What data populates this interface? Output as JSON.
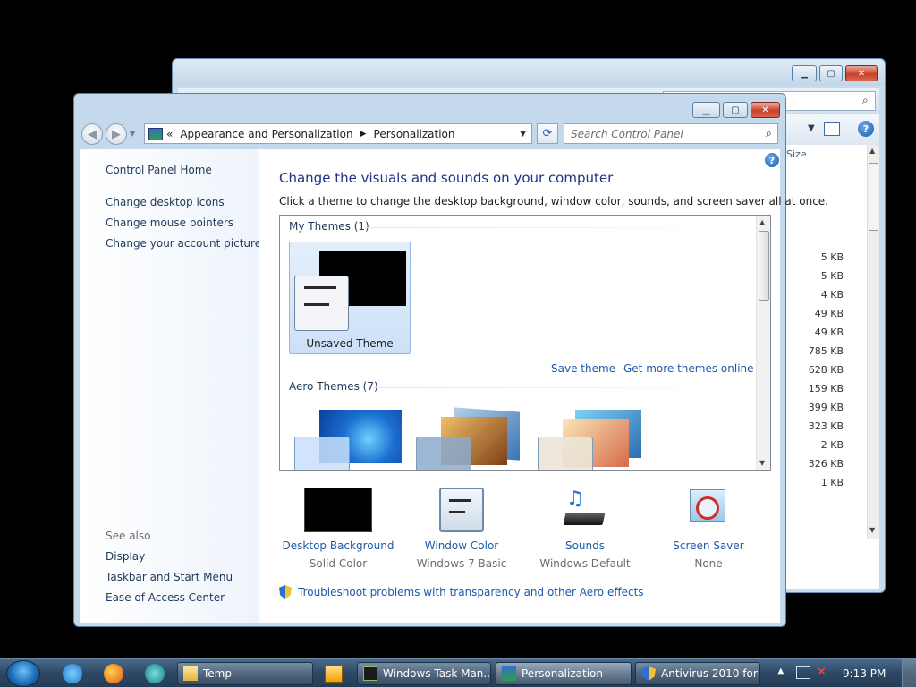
{
  "back_window": {
    "sizes": [
      "5 KB",
      "5 KB",
      "4 KB",
      "49 KB",
      "49 KB",
      "785 KB",
      "628 KB",
      "159 KB",
      "399 KB",
      "323 KB",
      "2 KB",
      "326 KB",
      "1 KB"
    ],
    "column_header": "Size"
  },
  "front_window": {
    "breadcrumb_prefix": "«",
    "breadcrumb_1": "Appearance and Personalization",
    "breadcrumb_2": "Personalization",
    "search_placeholder": "Search Control Panel",
    "left_pane": {
      "home": "Control Panel Home",
      "links": [
        "Change desktop icons",
        "Change mouse pointers",
        "Change your account picture"
      ],
      "see_also_title": "See also",
      "see_also": [
        "Display",
        "Taskbar and Start Menu",
        "Ease of Access Center"
      ]
    },
    "main": {
      "title": "Change the visuals and sounds on your computer",
      "description": "Click a theme to change the desktop background, window color, sounds, and screen saver all at once.",
      "my_themes_heading": "My Themes (1)",
      "unsaved_theme": "Unsaved Theme",
      "save_theme": "Save theme",
      "get_more_themes": "Get more themes online",
      "aero_themes_heading": "Aero Themes (7)",
      "bottom": [
        {
          "title": "Desktop Background",
          "value": "Solid Color"
        },
        {
          "title": "Window Color",
          "value": "Windows 7 Basic"
        },
        {
          "title": "Sounds",
          "value": "Windows Default"
        },
        {
          "title": "Screen Saver",
          "value": "None"
        }
      ],
      "troubleshoot": "Troubleshoot problems with transparency and other Aero effects"
    }
  },
  "taskbar": {
    "buttons": [
      "Temp",
      "Windows Task Man...",
      "Personalization",
      "Antivirus 2010 for ..."
    ],
    "clock": "9:13 PM"
  },
  "colors": {
    "accent_link": "#1e5aa8",
    "title_text": "#1e3287",
    "window_frame": "#c4d9ec",
    "close_button": "#c8412a"
  }
}
